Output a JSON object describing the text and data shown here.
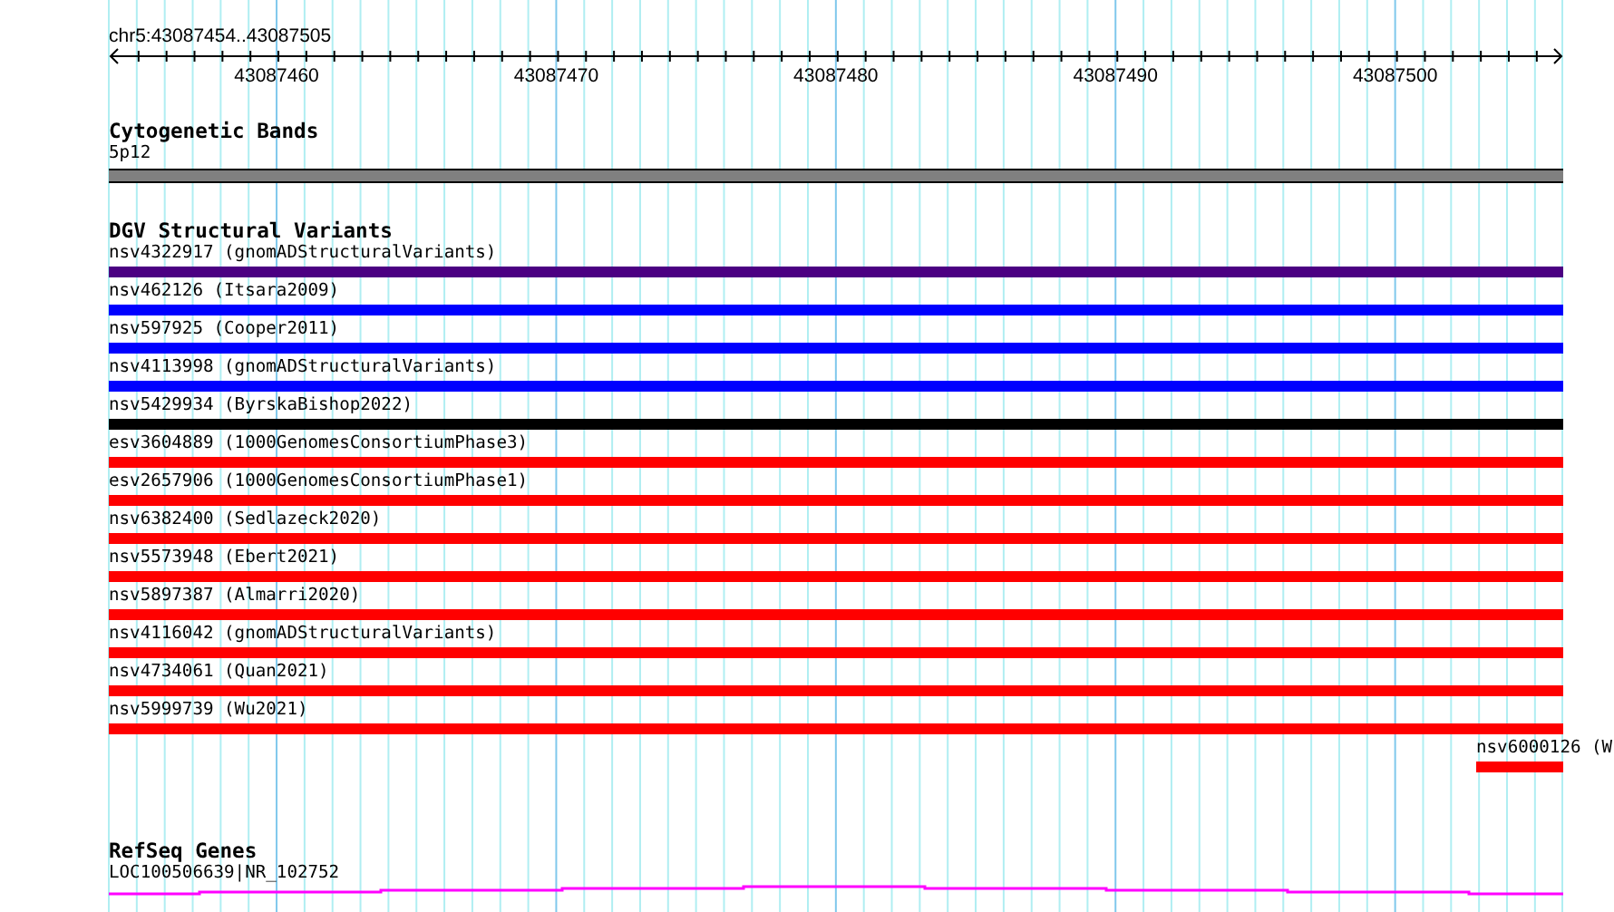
{
  "ruler": {
    "range_label": "chr5:43087454..43087505",
    "tick_labels": [
      "43087460",
      "43087470",
      "43087480",
      "43087490",
      "43087500"
    ]
  },
  "cytogenetic_bands": {
    "title": "Cytogenetic Bands",
    "band_label": "5p12"
  },
  "dgv_structural_variants": {
    "title": "DGV Structural Variants",
    "features": [
      {
        "label": "nsv4322917 (gnomADStructuralVariants)",
        "color": "#4b0082",
        "kind": "spanning"
      },
      {
        "label": "nsv462126 (Itsara2009)",
        "color": "#0000ff",
        "kind": "spanning"
      },
      {
        "label": "nsv597925 (Cooper2011)",
        "color": "#0000ff",
        "kind": "spanning"
      },
      {
        "label": "nsv4113998 (gnomADStructuralVariants)",
        "color": "#0000ff",
        "kind": "spanning"
      },
      {
        "label": "nsv5429934 (ByrskaBishop2022)",
        "color": "#000000",
        "kind": "spanning"
      },
      {
        "label": "esv3604889 (1000GenomesConsortiumPhase3)",
        "color": "#ff0000",
        "kind": "spanning"
      },
      {
        "label": "esv2657906 (1000GenomesConsortiumPhase1)",
        "color": "#ff0000",
        "kind": "spanning"
      },
      {
        "label": "nsv6382400 (Sedlazeck2020)",
        "color": "#ff0000",
        "kind": "spanning"
      },
      {
        "label": "nsv5573948 (Ebert2021)",
        "color": "#ff0000",
        "kind": "spanning"
      },
      {
        "label": "nsv5897387 (Almarri2020)",
        "color": "#ff0000",
        "kind": "spanning"
      },
      {
        "label": "nsv4116042 (gnomADStructuralVariants)",
        "color": "#ff0000",
        "kind": "spanning"
      },
      {
        "label": "nsv4734061 (Quan2021)",
        "color": "#ff0000",
        "kind": "spanning"
      },
      {
        "label": "nsv5999739 (Wu2021)",
        "color": "#ff0000",
        "kind": "spanning"
      },
      {
        "label": "nsv6000126 (W",
        "color": "#ff0000",
        "kind": "edge"
      }
    ]
  },
  "refseq_genes": {
    "title": "RefSeq Genes",
    "gene_label": "LOC100506639|NR_102752"
  }
}
